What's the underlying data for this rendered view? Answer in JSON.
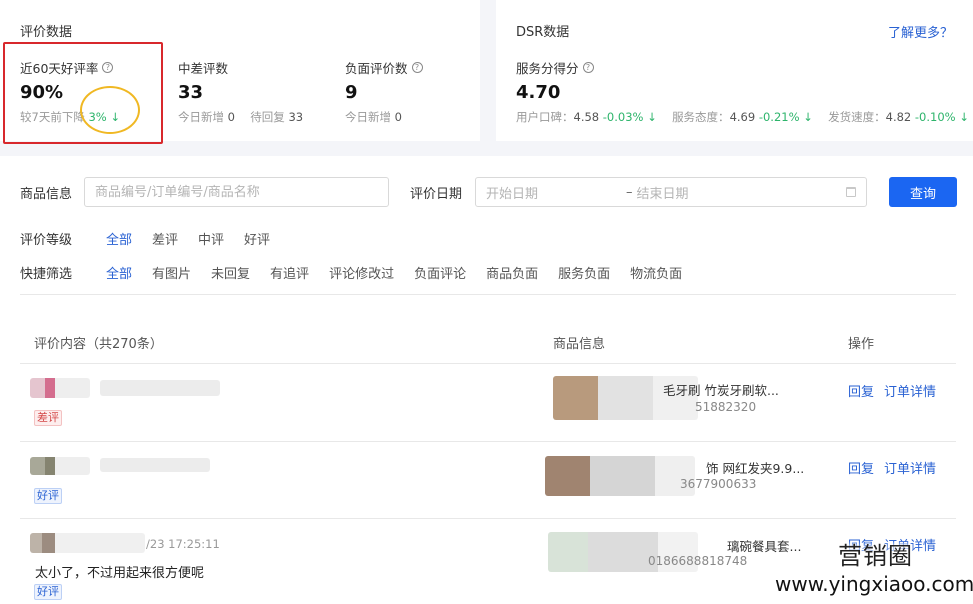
{
  "review_stats": {
    "title": "评价数据",
    "good_rate": {
      "label": "近60天好评率",
      "value": "90%",
      "sub_prefix": "较7天前下降",
      "sub_change": "3%",
      "trend_icon": "arrow-down-icon"
    },
    "mid_bad": {
      "label": "中差评数",
      "value": "33",
      "today_label": "今日新增",
      "today_value": "0",
      "pending_label": "待回复",
      "pending_value": "33"
    },
    "negative": {
      "label": "负面评价数",
      "value": "9",
      "today_label": "今日新增",
      "today_value": "0"
    }
  },
  "dsr": {
    "title": "DSR数据",
    "learn_more": "了解更多？",
    "score_label": "服务分得分",
    "score_value": "4.70",
    "items": [
      {
        "label": "用户口碑：",
        "value": "4.58",
        "change": "-0.03%"
      },
      {
        "label": "服务态度：",
        "value": "4.69",
        "change": "-0.21%"
      },
      {
        "label": "发货速度：",
        "value": "4.82",
        "change": "-0.10%"
      }
    ]
  },
  "filters": {
    "product_label": "商品信息",
    "product_placeholder": "商品编号/订单编号/商品名称",
    "date_label": "评价日期",
    "date_start_placeholder": "开始日期",
    "date_separator": "–",
    "date_end_placeholder": "结束日期",
    "query_button": "查询",
    "level_label": "评价等级",
    "level_options": [
      "全部",
      "差评",
      "中评",
      "好评"
    ],
    "level_selected": "全部",
    "quick_label": "快捷筛选",
    "quick_options": [
      "全部",
      "有图片",
      "未回复",
      "有追评",
      "评论修改过",
      "负面评论",
      "商品负面",
      "服务负面",
      "物流负面"
    ],
    "quick_selected": "全部"
  },
  "table": {
    "col_content": "评价内容（共270条）",
    "col_product": "商品信息",
    "col_action": "操作",
    "rows": [
      {
        "time": "",
        "text": "",
        "tag": "差评",
        "tag_type": "bad",
        "product_name": "毛牙刷 竹炭牙刷软...",
        "product_id": "51882320",
        "reply": "回复",
        "detail": "订单详情"
      },
      {
        "time": "",
        "text": "",
        "tag": "好评",
        "tag_type": "good",
        "product_name": "饰 网红发夹9.9...",
        "product_id": "3677900633",
        "reply": "回复",
        "detail": "订单详情"
      },
      {
        "time": "/23 17:25:11",
        "text": "太小了，不过用起来很方便呢",
        "tag": "好评",
        "tag_type": "good",
        "product_name": "璃碗餐具套...",
        "product_id": "0186688818748",
        "reply": "回复",
        "detail": "订单详情"
      }
    ]
  },
  "watermark": {
    "brand": "营销圈",
    "url": "www.yingxiaoo.com"
  },
  "colors": {
    "accent": "#2a62d3",
    "primary_button": "#1b66f2",
    "trend_down": "#2db46b",
    "bad_tag": "#d44848",
    "highlight_red": "#d8282c",
    "highlight_yellow": "#f0b823"
  }
}
